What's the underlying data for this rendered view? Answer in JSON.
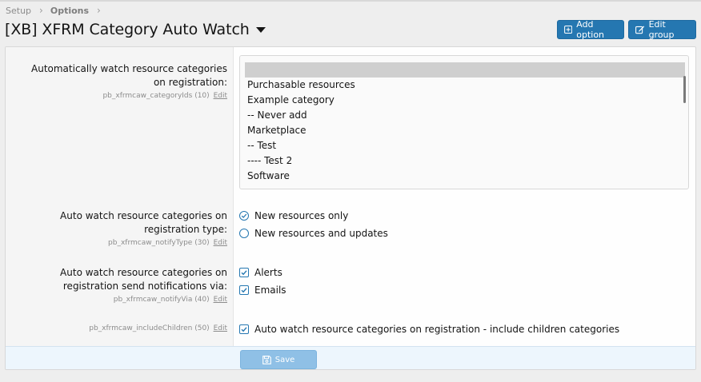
{
  "breadcrumb": {
    "items": [
      "Setup",
      "Options"
    ]
  },
  "page": {
    "title": "[XB] XFRM Category Auto Watch"
  },
  "toolbar": {
    "add_option": "Add option",
    "edit_group": "Edit group"
  },
  "options": {
    "category_ids": {
      "label": "Automatically watch resource categories on registration:",
      "hint": "pb_xfrmcaw_categoryIds (10)",
      "edit": "Edit",
      "items": [
        "",
        "Purchasable resources",
        "Example category",
        "-- Never add",
        "Marketplace",
        "-- Test",
        "---- Test 2",
        "Software"
      ]
    },
    "notify_type": {
      "label": "Auto watch resource categories on registration type:",
      "hint": "pb_xfrmcaw_notifyType (30)",
      "edit": "Edit",
      "choices": [
        "New resources only",
        "New resources and updates"
      ],
      "selected": 0
    },
    "notify_via": {
      "label": "Auto watch resource categories on registration send notifications via:",
      "hint": "pb_xfrmcaw_notifyVia (40)",
      "edit": "Edit",
      "choices": [
        "Alerts",
        "Emails"
      ]
    },
    "include_children": {
      "hint": "pb_xfrmcaw_includeChildren (50)",
      "edit": "Edit",
      "label": "Auto watch resource categories on registration - include children categories"
    }
  },
  "footer": {
    "save_label": "Save"
  },
  "colors": {
    "accent": "#2577b1",
    "save_bg": "#8fc0e6",
    "footer_bg": "#edf6fd"
  }
}
